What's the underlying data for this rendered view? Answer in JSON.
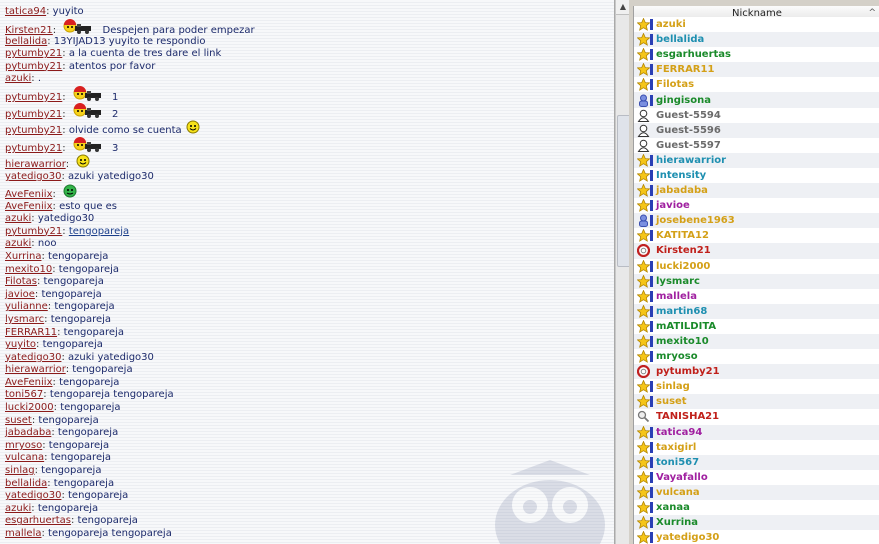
{
  "chat": {
    "messages": [
      {
        "nick": "tatica94",
        "text": "yuyito"
      },
      {
        "nick": "Kirsten21",
        "text": "Despejen para poder empezar",
        "emoticon": "cannon",
        "tall": true
      },
      {
        "nick": "bellalida",
        "text": "13YIJAD13 yuyito te respondio"
      },
      {
        "nick": "pytumby21",
        "text": "a la cuenta de tres dare el link"
      },
      {
        "nick": "pytumby21",
        "text": "atentos por favor"
      },
      {
        "nick": "azuki",
        "text": "."
      },
      {
        "nick": "pytumby21",
        "text": "1",
        "emoticon": "cannon",
        "tall": true
      },
      {
        "nick": "pytumby21",
        "text": "2",
        "emoticon": "cannon",
        "tall": true
      },
      {
        "nick": "pytumby21",
        "text": "olvide como se cuenta",
        "emoticon": "smile",
        "tall": true
      },
      {
        "nick": "pytumby21",
        "text": "3",
        "emoticon": "cannon",
        "tall": true
      },
      {
        "nick": "hierawarrior",
        "text": "",
        "emoticon": "smile",
        "tall": true
      },
      {
        "nick": "yatedigo30",
        "text": "azuki yatedigo30"
      },
      {
        "nick": "AveFeniix",
        "text": "",
        "emoticon": "green",
        "tall": true
      },
      {
        "nick": "AveFeniix",
        "text": "esto que es"
      },
      {
        "nick": "azuki",
        "text": "yatedigo30"
      },
      {
        "nick": "pytumby21",
        "text": "tengopareja",
        "link": true
      },
      {
        "nick": "azuki",
        "text": "noo"
      },
      {
        "nick": "Xurrina",
        "text": "tengopareja"
      },
      {
        "nick": "mexito10",
        "text": "tengopareja"
      },
      {
        "nick": "Filotas",
        "text": "tengopareja"
      },
      {
        "nick": "javioe",
        "text": "tengopareja"
      },
      {
        "nick": "yulianne",
        "text": "tengopareja"
      },
      {
        "nick": "lysmarc",
        "text": "tengopareja"
      },
      {
        "nick": "FERRAR11",
        "text": "tengopareja"
      },
      {
        "nick": "yuyito",
        "text": "tengopareja"
      },
      {
        "nick": "yatedigo30",
        "text": "azuki yatedigo30"
      },
      {
        "nick": "hierawarrior",
        "text": "tengopareja"
      },
      {
        "nick": "AveFeniix",
        "text": "tengopareja"
      },
      {
        "nick": "toni567",
        "text": "tengopareja tengopareja"
      },
      {
        "nick": "lucki2000",
        "text": "tengopareja"
      },
      {
        "nick": "suset",
        "text": "tengopareja"
      },
      {
        "nick": "jabadaba",
        "text": "tengopareja"
      },
      {
        "nick": "mryoso",
        "text": "tengopareja"
      },
      {
        "nick": "vulcana",
        "text": "tengopareja"
      },
      {
        "nick": "sinlag",
        "text": "tengopareja"
      },
      {
        "nick": "bellalida",
        "text": "tengopareja"
      },
      {
        "nick": "yatedigo30",
        "text": "tengopareja"
      },
      {
        "nick": "azuki",
        "text": "tengopareja"
      },
      {
        "nick": "esgarhuertas",
        "text": "tengopareja"
      },
      {
        "nick": "mallela",
        "text": "tengopareja tengopareja"
      }
    ]
  },
  "userlist": {
    "header": "Nickname",
    "users": [
      {
        "name": "azuki",
        "color": "#d4a017",
        "icon": "star-icon",
        "bar": true
      },
      {
        "name": "bellalida",
        "color": "#1e8fb0",
        "icon": "star-icon",
        "bar": true
      },
      {
        "name": "esgarhuertas",
        "color": "#1a8a2a",
        "icon": "star-icon",
        "bar": true
      },
      {
        "name": "FERRAR11",
        "color": "#d4a017",
        "icon": "star-icon",
        "bar": true
      },
      {
        "name": "Filotas",
        "color": "#d4a017",
        "icon": "star-icon",
        "bar": true
      },
      {
        "name": "gingisona",
        "color": "#1a8a2a",
        "icon": "user-blue-icon",
        "bar": true
      },
      {
        "name": "Guest-5594",
        "color": "#6b6b6b",
        "icon": "guest-icon",
        "bar": false
      },
      {
        "name": "Guest-5596",
        "color": "#6b6b6b",
        "icon": "guest-icon",
        "bar": false
      },
      {
        "name": "Guest-5597",
        "color": "#6b6b6b",
        "icon": "guest-icon",
        "bar": false
      },
      {
        "name": "hierawarrior",
        "color": "#1e8fb0",
        "icon": "star-icon",
        "bar": true
      },
      {
        "name": "Intensity",
        "color": "#1e8fb0",
        "icon": "star-icon",
        "bar": true
      },
      {
        "name": "jabadaba",
        "color": "#d4a017",
        "icon": "star-icon",
        "bar": true
      },
      {
        "name": "javioe",
        "color": "#a020a0",
        "icon": "star-icon",
        "bar": true
      },
      {
        "name": "josebene1963",
        "color": "#d4a017",
        "icon": "user-blue-icon",
        "bar": true
      },
      {
        "name": "KATITA12",
        "color": "#d4a017",
        "icon": "star-icon",
        "bar": true
      },
      {
        "name": "Kirsten21",
        "color": "#c0201a",
        "icon": "lifebuoy-icon",
        "bar": false
      },
      {
        "name": "lucki2000",
        "color": "#d4a017",
        "icon": "star-icon",
        "bar": true
      },
      {
        "name": "lysmarc",
        "color": "#1a8a2a",
        "icon": "star-icon",
        "bar": true
      },
      {
        "name": "mallela",
        "color": "#a020a0",
        "icon": "star-icon",
        "bar": true
      },
      {
        "name": "martin68",
        "color": "#1e8fb0",
        "icon": "star-icon",
        "bar": true
      },
      {
        "name": "mATILDITA",
        "color": "#1a8a2a",
        "icon": "star-icon",
        "bar": true
      },
      {
        "name": "mexito10",
        "color": "#1a8a2a",
        "icon": "star-icon",
        "bar": true
      },
      {
        "name": "mryoso",
        "color": "#1a8a2a",
        "icon": "star-icon",
        "bar": true
      },
      {
        "name": "pytumby21",
        "color": "#c0201a",
        "icon": "lifebuoy-icon",
        "bar": false
      },
      {
        "name": "sinlag",
        "color": "#d4a017",
        "icon": "star-icon",
        "bar": true
      },
      {
        "name": "suset",
        "color": "#d4a017",
        "icon": "star-icon",
        "bar": true
      },
      {
        "name": "TANISHA21",
        "color": "#c0201a",
        "icon": "magnifier-icon",
        "bar": false
      },
      {
        "name": "tatica94",
        "color": "#a020a0",
        "icon": "star-icon",
        "bar": true
      },
      {
        "name": "taxigirl",
        "color": "#d4a017",
        "icon": "star-icon",
        "bar": true
      },
      {
        "name": "toni567",
        "color": "#1e8fb0",
        "icon": "star-icon",
        "bar": true
      },
      {
        "name": "Vayafallo",
        "color": "#a020a0",
        "icon": "star-icon",
        "bar": true
      },
      {
        "name": "vulcana",
        "color": "#d4a017",
        "icon": "star-icon",
        "bar": true
      },
      {
        "name": "xanaa",
        "color": "#1a8a2a",
        "icon": "star-icon",
        "bar": true
      },
      {
        "name": "Xurrina",
        "color": "#1a8a2a",
        "icon": "star-icon",
        "bar": true
      },
      {
        "name": "yatedigo30",
        "color": "#d4a017",
        "icon": "star-icon",
        "bar": true
      }
    ]
  }
}
